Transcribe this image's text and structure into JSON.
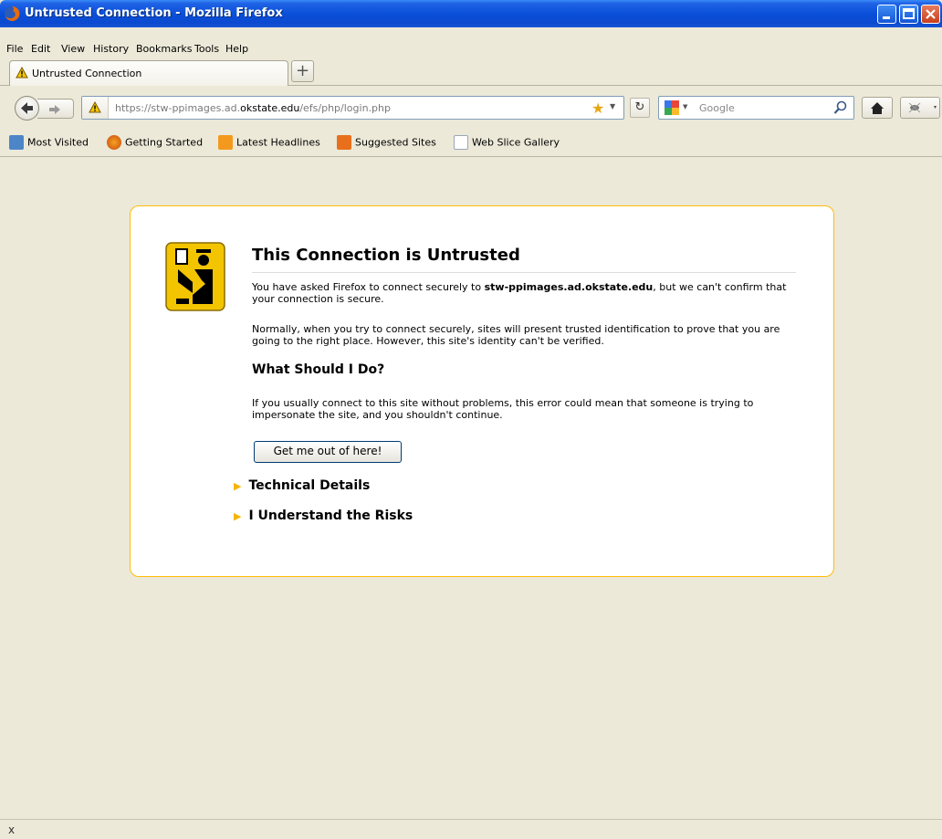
{
  "window": {
    "title": "Untrusted Connection - Mozilla Firefox"
  },
  "menu": {
    "items": [
      "File",
      "Edit",
      "View",
      "History",
      "Bookmarks",
      "Tools",
      "Help"
    ]
  },
  "tabs": [
    {
      "label": "Untrusted Connection",
      "icon": "warning-icon"
    }
  ],
  "navbar": {
    "url_prefix": "https://stw-ppimages.ad.",
    "url_domain": "okstate.edu",
    "url_suffix": "/efs/php/login.php",
    "search_placeholder": "Google"
  },
  "bookmarks": [
    {
      "label": "Most Visited",
      "icon": "most-visited-icon"
    },
    {
      "label": "Getting Started",
      "icon": "firefox-icon"
    },
    {
      "label": "Latest Headlines",
      "icon": "rss-icon"
    },
    {
      "label": "Suggested Sites",
      "icon": "suggested-sites-icon"
    },
    {
      "label": "Web Slice Gallery",
      "icon": "page-icon"
    }
  ],
  "error": {
    "title": "This Connection is Untrusted",
    "para1_before": "You have asked Firefox to connect securely to ",
    "para1_host": "stw-ppimages.ad.okstate.edu",
    "para1_after": ", but we can't confirm that your connection is secure.",
    "para2": "Normally, when you try to connect securely, sites will present trusted identification to prove that you are going to the right place. However, this site's identity can't be verified.",
    "subheading": "What Should I Do?",
    "para3": "If you usually connect to this site without problems, this error could mean that someone is trying to impersonate the site, and you shouldn't continue.",
    "escape_button": "Get me out of here!",
    "expanders": [
      "Technical Details",
      "I Understand the Risks"
    ]
  },
  "statusbar": {
    "close_label": "x"
  },
  "colors": {
    "titlebar": "#0a4fd8",
    "chrome": "#ece9d8",
    "error_border": "#ffbd09",
    "expander_triangle": "#f4b400"
  }
}
